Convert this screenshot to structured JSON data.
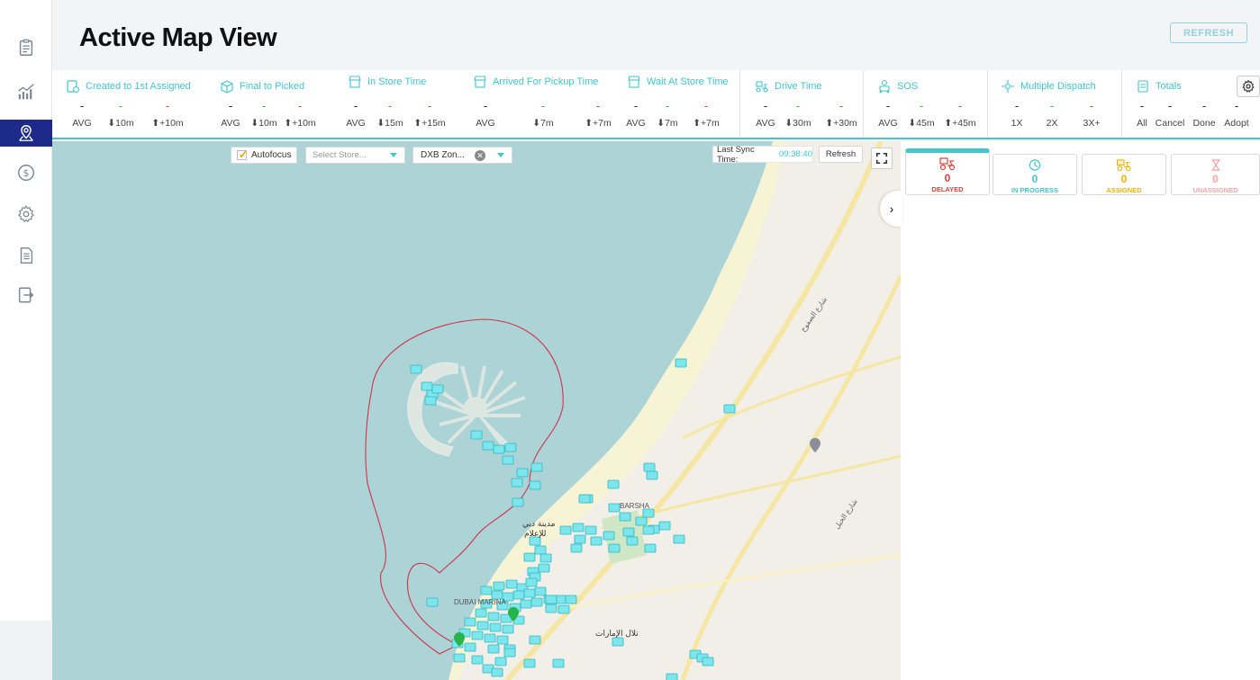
{
  "page": {
    "title": "Active Map View",
    "refresh_button": "REFRESH"
  },
  "sidebar": {
    "items": [
      {
        "icon": "clipboard-icon",
        "active": false
      },
      {
        "icon": "chart-icon",
        "active": false
      },
      {
        "icon": "map-pin-icon",
        "active": true
      },
      {
        "icon": "dollar-icon",
        "active": false
      },
      {
        "icon": "gear-icon",
        "active": false
      },
      {
        "icon": "document-icon",
        "active": false
      },
      {
        "icon": "logout-icon",
        "active": false
      }
    ]
  },
  "metrics": [
    {
      "title": "Created to 1st Assigned",
      "values": [
        "-",
        "-",
        "-"
      ],
      "labels": [
        "AVG",
        "⬇10m",
        "⬆+10m"
      ]
    },
    {
      "title": "Final to Picked",
      "values": [
        "-",
        "-",
        "-"
      ],
      "labels": [
        "AVG",
        "⬇10m",
        "⬆+10m"
      ]
    },
    {
      "title": "In Store Time",
      "values": [
        "-",
        "-",
        "-"
      ],
      "labels": [
        "AVG",
        "⬇15m",
        "⬆+15m"
      ]
    },
    {
      "title": "Arrived For Pickup Time",
      "values": [
        "-",
        "-",
        "-"
      ],
      "labels": [
        "AVG",
        "⬇7m",
        "⬆+7m"
      ]
    },
    {
      "title": "Wait At Store Time",
      "values": [
        "-",
        "-",
        "-"
      ],
      "labels": [
        "AVG",
        "⬇7m",
        "⬆+7m"
      ]
    },
    {
      "title": "Drive Time",
      "values": [
        "-",
        "-",
        "-"
      ],
      "labels": [
        "AVG",
        "⬇30m",
        "⬆+30m"
      ]
    },
    {
      "title": "SOS",
      "values": [
        "-",
        "-",
        "-"
      ],
      "labels": [
        "AVG",
        "⬇45m",
        "⬆+45m"
      ]
    },
    {
      "title": "Multiple Dispatch",
      "values": [
        "-",
        "-",
        "-"
      ],
      "labels": [
        "1X",
        "2X",
        "3X+"
      ]
    },
    {
      "title": "Totals",
      "values": [
        "-",
        "-",
        "-",
        "-"
      ],
      "labels": [
        "All",
        "Cancel",
        "Done",
        "Adopt"
      ]
    }
  ],
  "map": {
    "autofocus_label": "Autofocus",
    "autofocus_checked": true,
    "store_placeholder": "Select Store...",
    "zone_value": "DXB Zon...",
    "last_sync_label": "Last Sync Time:",
    "last_sync_value": "09:38:40",
    "refresh_label": "Refresh",
    "place_labels": {
      "arabic_1": "مدينة دبي",
      "arabic_2": "للإعلام",
      "barsha": "BARSHA",
      "dubai_marina": "DUBAI MARINA",
      "emirates_hills": "تلال الإمارات",
      "road_1": "شارع الصفوح",
      "road_2": "شارع الخيل"
    }
  },
  "status_cards": [
    {
      "count": "0",
      "label": "DELAYED",
      "color": "#e0403a",
      "icon": "delayed-scooter-icon"
    },
    {
      "count": "0",
      "label": "IN PROGRESS",
      "color": "#43c7cf",
      "icon": "clock-icon"
    },
    {
      "count": "0",
      "label": "ASSIGNED",
      "color": "#f0b400",
      "icon": "assigned-scooter-icon"
    },
    {
      "count": "0",
      "label": "UNASSIGNED",
      "color": "#f2a6a6",
      "icon": "hourglass-icon"
    }
  ],
  "colors": {
    "accent": "#43c7cf",
    "nav_active": "#1d2a8a",
    "zone_border": "#d1334a"
  }
}
